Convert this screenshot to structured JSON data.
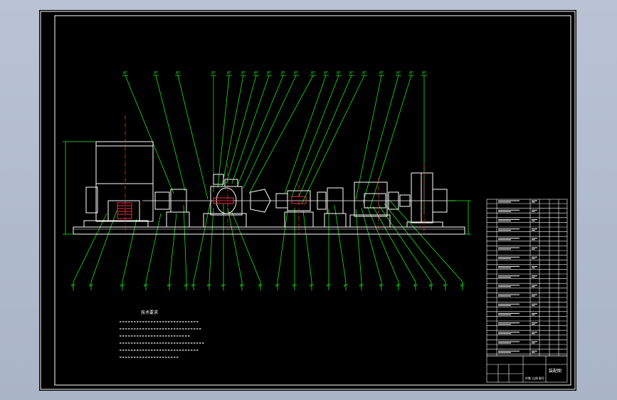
{
  "drawing": {
    "colors": {
      "background_outer": "#b9c3d3",
      "sheet": "#000000",
      "frame": "#ffffff",
      "leader": "#19e619",
      "machine": "#ffffff",
      "centerline": "#e8323c",
      "dimension": "#19e619",
      "hatch": "#e8323c"
    },
    "title_block": {
      "label": "装配图",
      "bottom_row": [
        "件数",
        "比例",
        "图号"
      ]
    },
    "technical_requirements": {
      "heading": "技术要求"
    }
  }
}
